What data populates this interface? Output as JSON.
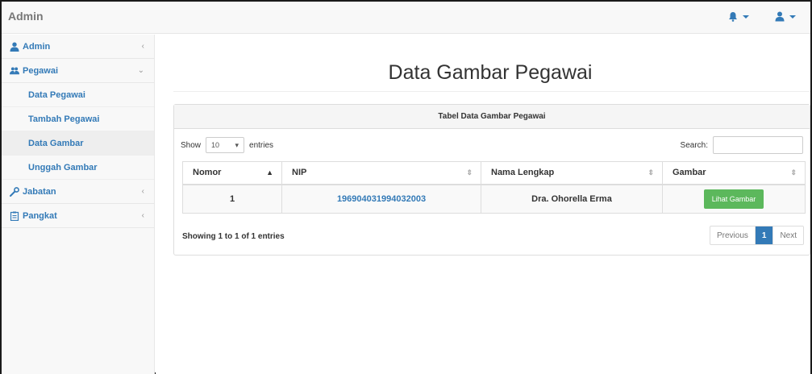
{
  "app": {
    "brand": "Admin"
  },
  "sidebar": {
    "items": [
      {
        "label": "Admin",
        "icon": "user-icon",
        "chevron": "‹"
      },
      {
        "label": "Pegawai",
        "icon": "users-icon",
        "chevron": "⌄",
        "children": [
          {
            "label": "Data Pegawai"
          },
          {
            "label": "Tambah Pegawai"
          },
          {
            "label": "Data Gambar"
          },
          {
            "label": "Unggah Gambar"
          }
        ]
      },
      {
        "label": "Jabatan",
        "icon": "wrench-icon",
        "chevron": "‹"
      },
      {
        "label": "Pangkat",
        "icon": "clipboard-icon",
        "chevron": "‹"
      }
    ],
    "active_child": "Data Gambar"
  },
  "main": {
    "title": "Data Gambar Pegawai",
    "panel_title": "Tabel Data Gambar Pegawai",
    "show_label": "Show",
    "entries_label": "entries",
    "page_length": "10",
    "search_label": "Search:",
    "search_value": "",
    "columns": [
      "Nomor",
      "NIP",
      "Nama Lengkap",
      "Gambar"
    ],
    "rows": [
      {
        "nomor": "1",
        "nip": "196904031994032003",
        "nama": "Dra. Ohorella Erma",
        "action": "Lihat Gambar"
      }
    ],
    "info": "Showing 1 to 1 of 1 entries",
    "pager": {
      "prev": "Previous",
      "current": "1",
      "next": "Next"
    }
  },
  "colors": {
    "link": "#337ab7",
    "success": "#5cb85c",
    "navbar_bg": "#f8f8f8"
  }
}
